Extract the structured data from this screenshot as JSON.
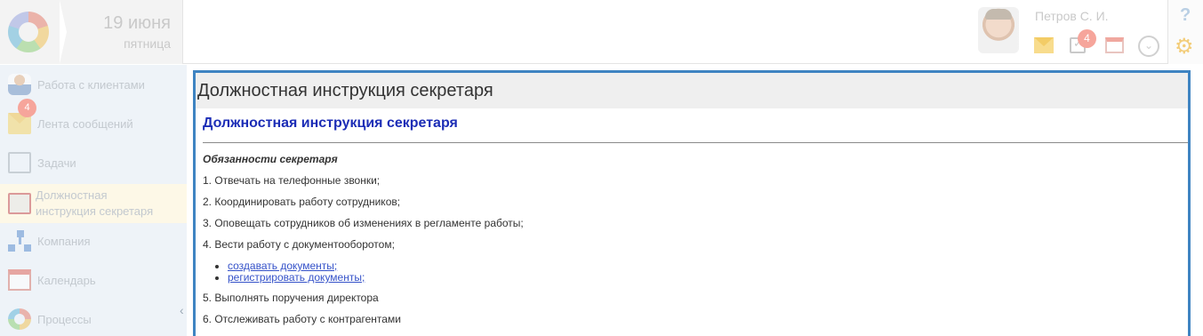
{
  "header": {
    "date_day": "19 июня",
    "date_weekday": "пятница",
    "user_name": "Петров С. И.",
    "tasks_badge": "4",
    "help_label": "?"
  },
  "sidebar": {
    "items": [
      {
        "label": "Работа с клиентами",
        "icon": "clients-icon"
      },
      {
        "label": "Лента сообщений",
        "icon": "messages-icon"
      },
      {
        "label": "Задачи",
        "icon": "tasks-icon"
      },
      {
        "label": "Должностная инструкция секретаря",
        "icon": "document-icon",
        "active": true
      },
      {
        "label": "Компания",
        "icon": "company-icon"
      },
      {
        "label": "Календарь",
        "icon": "calendar-icon"
      },
      {
        "label": "Процессы",
        "icon": "processes-icon"
      }
    ],
    "tasks_badge": "4"
  },
  "panel": {
    "title": "Должностная инструкция секретаря"
  },
  "document": {
    "title": "Должностная инструкция секретаря",
    "subtitle": "Обязанности секретаря",
    "items": [
      "1. Отвечать на телефонные звонки;",
      "2. Координировать работу сотрудников;",
      "3. Оповещать сотрудников об изменениях в регламенте работы;",
      "4. Вести работу с документооборотом;"
    ],
    "links": [
      "создавать документы;",
      "регистрировать документы;"
    ],
    "items_after": [
      "5. Выполнять поручения директора",
      "6. Отслеживать работу с контрагентами"
    ]
  },
  "colors": {
    "accent_border": "#3f84c2",
    "doc_title": "#1c2db6",
    "badge": "#f6a59b"
  }
}
